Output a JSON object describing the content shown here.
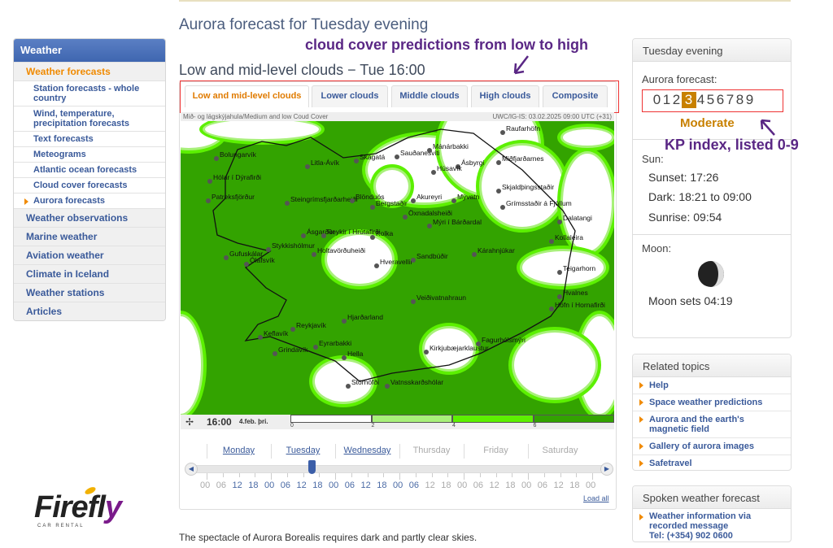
{
  "page": {
    "title": "Aurora forecast for Tuesday evening",
    "subtitle": "Low and mid-level clouds − Tue 16:00",
    "footer_text": "The spectacle of Aurora Borealis requires dark and partly clear skies."
  },
  "annotations": {
    "tabs_note": "cloud cover predictions from low to high",
    "kp_note": "KP index, listed 0-9",
    "color": "#5a2785"
  },
  "sidebar": {
    "header": "Weather",
    "items": [
      {
        "label": "Weather forecasts",
        "active": true
      },
      {
        "label": "Station forecasts - whole country",
        "sub": true
      },
      {
        "label": "Wind, temperature, precipitation forecasts",
        "sub": true
      },
      {
        "label": "Text forecasts",
        "sub": true
      },
      {
        "label": "Meteograms",
        "sub": true
      },
      {
        "label": "Atlantic ocean forecasts",
        "sub": true
      },
      {
        "label": "Cloud cover forecasts",
        "sub": true
      },
      {
        "label": "Aurora forecasts",
        "sub": true,
        "current": true
      },
      {
        "label": "Weather observations"
      },
      {
        "label": "Marine weather"
      },
      {
        "label": "Aviation weather"
      },
      {
        "label": "Climate in Iceland"
      },
      {
        "label": "Weather stations"
      },
      {
        "label": "Articles"
      }
    ]
  },
  "tabs": [
    {
      "label": "Low and mid-level clouds",
      "active": true
    },
    {
      "label": "Lower clouds"
    },
    {
      "label": "Middle clouds"
    },
    {
      "label": "High clouds"
    },
    {
      "label": "Composite"
    }
  ],
  "map": {
    "caption_left": "Mið- og lágskýjahula/Medium and low Coud Cover",
    "caption_right": "UWC/IG-IS: 03.02.2025 09:00 UTC (+31)",
    "time": "16:00",
    "date": "4.feb. þri.",
    "legend": {
      "ticks": [
        "0",
        "2",
        "4",
        "6"
      ],
      "colors": [
        "#ffffff",
        "#a8f07a",
        "#5cf000",
        "#33a300"
      ]
    },
    "places": [
      "Raufarhöfn",
      "Bolungarvík",
      "Litla-Ávík",
      "Skagatá",
      "Sauðanesviti",
      "Mánárbakki",
      "Miðfjarðarnes",
      "Hólar í Dýrafirði",
      "Ásbyrgi",
      "Húsavík",
      "Skjaldþingsstaðir",
      "Patreksfjörður",
      "Steingrímsfjarðarheiði",
      "Blönduós",
      "Bergstaðir",
      "Akureyri",
      "Mývatn",
      "Grímsstaðir á Fjöllum",
      "Dalatangi",
      "Öxnadalsheiði",
      "Mýri í Bárðardal",
      "Ásgarður",
      "Reykir í Hrútafirði",
      "Kolka",
      "Kollaleira",
      "Stykkishólmur",
      "Kárahnjúkar",
      "Gufuskálar",
      "Ólafsvík",
      "Holtavörðuheiði",
      "Hveravellir",
      "Sandbúðir",
      "Teigarhorn",
      "Hvalnes",
      "Veiðivatnahraun",
      "Höfn í Hornafirði",
      "Hjarðarland",
      "Reykjavík",
      "Keflavík",
      "Eyrarbakki",
      "Grindavík",
      "Hella",
      "Fagurhólsmýri",
      "Kirkjubæjarklaustur",
      "Stórhöfði",
      "Vatnsskarðshólar"
    ]
  },
  "timeline": {
    "days": [
      {
        "label": "Monday",
        "available": true
      },
      {
        "label": "Tuesday",
        "available": true
      },
      {
        "label": "Wednesday",
        "available": true
      },
      {
        "label": "Thursday",
        "available": false
      },
      {
        "label": "Friday",
        "available": false
      },
      {
        "label": "Saturday",
        "available": false
      }
    ],
    "hours": [
      "00",
      "06",
      "12",
      "18",
      "00",
      "06",
      "12",
      "18",
      "00",
      "06",
      "12",
      "18",
      "00",
      "06",
      "12",
      "18",
      "00",
      "06",
      "12",
      "18",
      "00",
      "06",
      "12",
      "18",
      "00"
    ],
    "hours_available_from": 2,
    "hours_available_to": 13,
    "selected": "Tuesday 16:00",
    "load_all": "Load all"
  },
  "aurora": {
    "header": "Tuesday evening",
    "label": "Aurora forecast:",
    "scale": [
      "0",
      "1",
      "2",
      "3",
      "4",
      "5",
      "6",
      "7",
      "8",
      "9"
    ],
    "selected": 3,
    "level": "Moderate",
    "level_color": "#c88000",
    "sun_label": "Sun:",
    "sunset": "Sunset: 17:26",
    "dark": "Dark: 18:21 to 09:00",
    "sunrise": "Sunrise: 09:54",
    "moon_label": "Moon:",
    "moon_sets": "Moon sets 04:19"
  },
  "related": {
    "header": "Related topics",
    "links": [
      "Help",
      "Space weather predictions",
      "Aurora and the earth's magnetic field",
      "Gallery of aurora images",
      "Safetravel"
    ]
  },
  "spoken": {
    "header": "Spoken weather forecast",
    "line1": "Weather information via recorded message",
    "line2": "Tel: (+354) 902 0600"
  },
  "logo": {
    "text": "Firefly",
    "tagline": "CAR RENTAL"
  }
}
